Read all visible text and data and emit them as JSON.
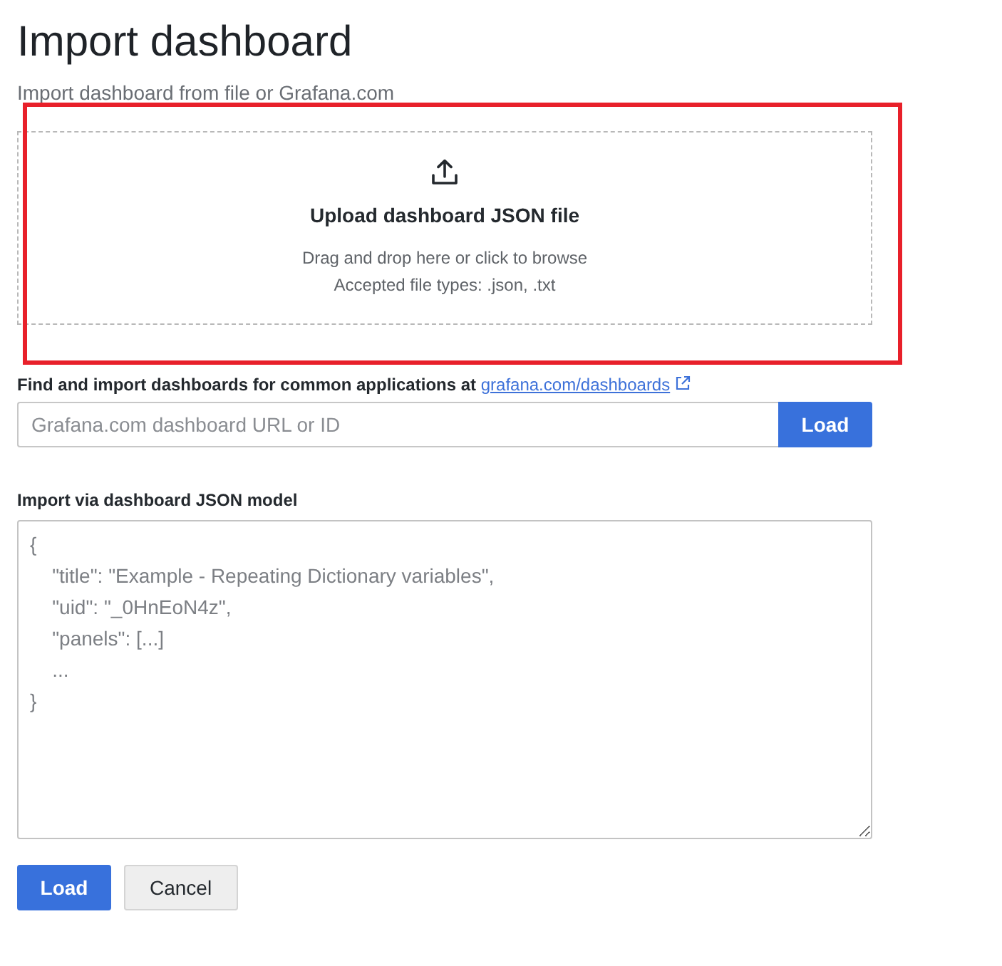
{
  "page": {
    "title": "Import dashboard",
    "subtitle": "Import dashboard from file or Grafana.com"
  },
  "upload": {
    "title": "Upload dashboard JSON file",
    "hint": "Drag and drop here or click to browse",
    "accepted": "Accepted file types: .json, .txt"
  },
  "annotation": {
    "kind": "rectangle"
  },
  "grafana_import": {
    "label": "Find and import dashboards for common applications at",
    "link": "grafana.com/dashboards",
    "input": {
      "placeholder": "Grafana.com dashboard URL or ID"
    },
    "button": "Load"
  },
  "json_import": {
    "label": "Import via dashboard JSON model",
    "textarea": {
      "placeholder": "{\n    \"title\": \"Example - Repeating Dictionary variables\",\n    \"uid\": \"_0HnEoN4z\",\n    \"panels\": [...]\n    ...\n}"
    }
  },
  "buttons": [
    {
      "label": "Load",
      "kind": "primary"
    },
    {
      "label": "Cancel",
      "kind": "secondary"
    }
  ]
}
